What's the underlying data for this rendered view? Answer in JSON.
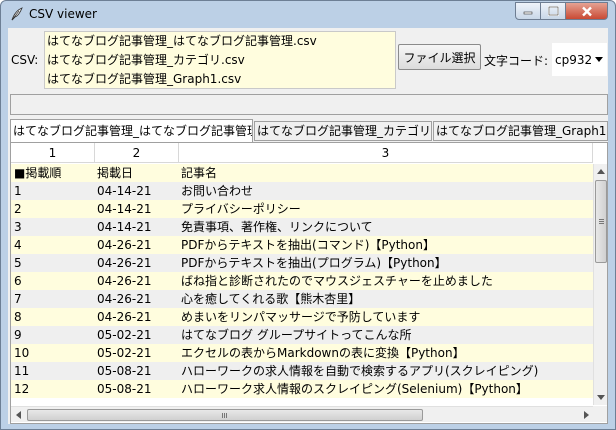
{
  "window": {
    "title": "CSV viewer"
  },
  "toolbar": {
    "csv_label": "CSV:",
    "files": [
      "はてなブログ記事管理_はてなブログ記事管理.csv",
      "はてなブログ記事管理_カテゴリ.csv",
      "はてなブログ記事管理_Graph1.csv"
    ],
    "file_button": "ファイル選択",
    "encoding_label": "文字コード:",
    "encoding_value": "cp932"
  },
  "status": "",
  "tabs": [
    "はてなブログ記事管理_はてなブログ記事管理",
    "はてなブログ記事管理_カテゴリ",
    "はてなブログ記事管理_Graph1"
  ],
  "table": {
    "col_numbers": [
      "1",
      "2",
      "3"
    ],
    "rows": [
      [
        "■掲載順",
        "掲載日",
        "記事名"
      ],
      [
        "1",
        "04-14-21",
        "お問い合わせ"
      ],
      [
        "2",
        "04-14-21",
        "プライバシーポリシー"
      ],
      [
        "3",
        "04-14-21",
        "免責事項、著作権、リンクについて"
      ],
      [
        "4",
        "04-26-21",
        "PDFからテキストを抽出(コマンド)【Python】"
      ],
      [
        "5",
        "04-26-21",
        "PDFからテキストを抽出(プログラム)【Python】"
      ],
      [
        "6",
        "04-26-21",
        "ばね指と診断されたのでマウスジェスチャーを止めました"
      ],
      [
        "7",
        "04-26-21",
        "心を癒してくれる歌【熊木杏里】"
      ],
      [
        "8",
        "04-26-21",
        "めまいをリンパマッサージで予防しています"
      ],
      [
        "9",
        "05-02-21",
        "はてなブログ グループサイトってこんな所"
      ],
      [
        "10",
        "05-02-21",
        "エクセルの表からMarkdownの表に変換【Python】"
      ],
      [
        "11",
        "05-08-21",
        "ハローワークの求人情報を自動で検索するアプリ(スクレイピング)"
      ],
      [
        "12",
        "05-08-21",
        "ハローワーク求人情報のスクレイピング(Selenium)【Python】"
      ]
    ]
  }
}
